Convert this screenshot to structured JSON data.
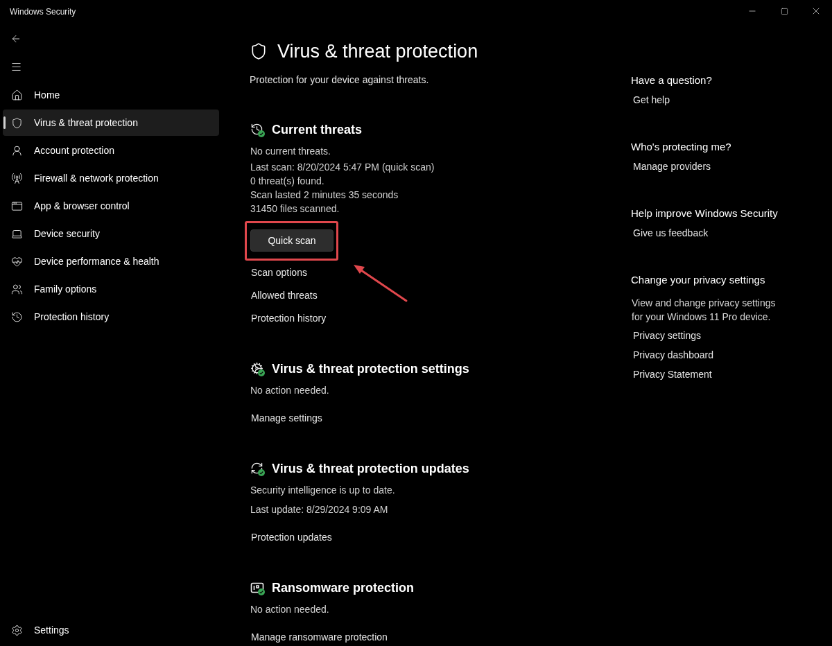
{
  "window": {
    "title": "Windows Security"
  },
  "sidebar": {
    "items": [
      {
        "label": "Home",
        "selected": false
      },
      {
        "label": "Virus & threat protection",
        "selected": true
      },
      {
        "label": "Account protection",
        "selected": false
      },
      {
        "label": "Firewall & network protection",
        "selected": false
      },
      {
        "label": "App & browser control",
        "selected": false
      },
      {
        "label": "Device security",
        "selected": false
      },
      {
        "label": "Device performance & health",
        "selected": false
      },
      {
        "label": "Family options",
        "selected": false
      },
      {
        "label": "Protection history",
        "selected": false
      }
    ],
    "footer": {
      "label": "Settings"
    }
  },
  "page": {
    "title": "Virus & threat protection",
    "subtitle": "Protection for your device against threats."
  },
  "sections": [
    {
      "heading": "Current threats",
      "lines": [
        "No current threats."
      ],
      "details": [
        "Last scan: 8/20/2024 5:47 PM (quick scan)",
        "0 threat(s) found.",
        "Scan lasted 2 minutes 35 seconds",
        "31450 files scanned."
      ],
      "button": {
        "label": "Quick scan",
        "highlighted": true
      },
      "links": [
        "Scan options",
        "Allowed threats",
        "Protection history"
      ]
    },
    {
      "heading": "Virus & threat protection settings",
      "lines": [
        "No action needed."
      ],
      "links": [
        "Manage settings"
      ]
    },
    {
      "heading": "Virus & threat protection updates",
      "lines": [
        "Security intelligence is up to date.",
        "Last update: 8/29/2024 9:09 AM"
      ],
      "links": [
        "Protection updates"
      ]
    },
    {
      "heading": "Ransomware protection",
      "lines": [
        "No action needed."
      ],
      "links": [
        "Manage ransomware protection"
      ]
    }
  ],
  "aside": {
    "groups": [
      {
        "heading": "Have a question?",
        "links": [
          "Get help"
        ]
      },
      {
        "heading": "Who's protecting me?",
        "links": [
          "Manage providers"
        ]
      },
      {
        "heading": "Help improve Windows Security",
        "links": [
          "Give us feedback"
        ]
      },
      {
        "heading": "Change your privacy settings",
        "text": "View and change privacy settings for your Windows 11 Pro device.",
        "links": [
          "Privacy settings",
          "Privacy dashboard",
          "Privacy Statement"
        ]
      }
    ]
  }
}
